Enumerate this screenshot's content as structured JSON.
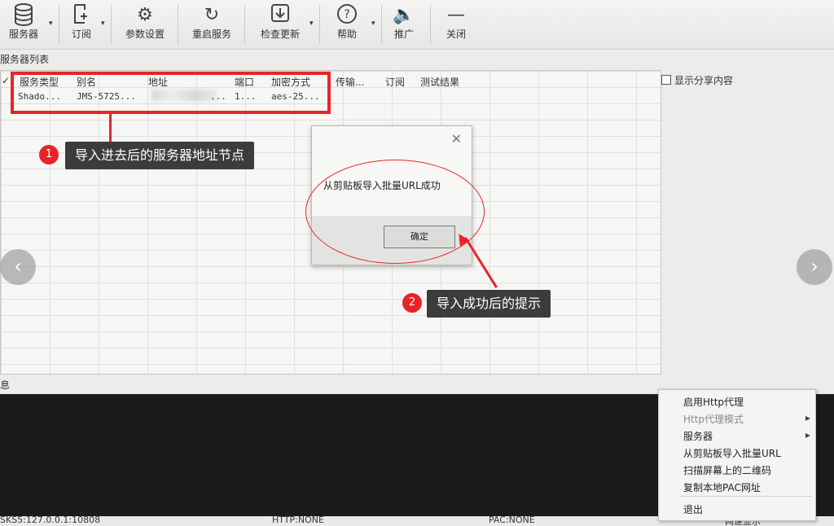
{
  "toolbar": {
    "items": [
      {
        "label": "服务器",
        "icon": "database-icon"
      },
      {
        "label": "订阅",
        "icon": "subscribe-icon"
      },
      {
        "label": "参数设置",
        "icon": "gear-icon"
      },
      {
        "label": "重启服务",
        "icon": "restart-icon"
      },
      {
        "label": "检查更新",
        "icon": "download-icon"
      },
      {
        "label": "帮助",
        "icon": "help-icon"
      },
      {
        "label": "推广",
        "icon": "speaker-icon"
      },
      {
        "label": "关闭",
        "icon": "minus-icon"
      }
    ]
  },
  "server_list": {
    "title": "服务器列表",
    "columns": [
      "服务类型",
      "别名",
      "地址",
      "端口",
      "加密方式",
      "传输...",
      "订阅",
      "测试结果"
    ],
    "rows": [
      {
        "type": "Shado...",
        "alias": "JMS-5725...",
        "address": "...",
        "port": "1...",
        "encryption": "aes-25..."
      }
    ],
    "show_share": "显示分享内容"
  },
  "dialog": {
    "message": "从剪贴板导入批量URL成功",
    "ok_label": "确定",
    "close_glyph": "✕"
  },
  "annotations": [
    {
      "badge": "1",
      "text": "导入进去后的服务器地址节点"
    },
    {
      "badge": "2",
      "text": "导入成功后的提示"
    }
  ],
  "info_label": "息",
  "status_bar": {
    "left": "SKS5:127.0.0.1:10808",
    "http": "HTTP:NONE",
    "pac": "PAC:NONE",
    "speed": "网速显示"
  },
  "context_menu": {
    "items": [
      {
        "label": "启用Http代理",
        "disabled": false
      },
      {
        "label": "Http代理模式",
        "disabled": true
      },
      {
        "label": "服务器",
        "disabled": false
      },
      {
        "label": "从剪贴板导入批量URL",
        "disabled": false
      },
      {
        "label": "扫描屏幕上的二维码",
        "disabled": false
      },
      {
        "label": "复制本地PAC网址",
        "disabled": false
      },
      {
        "label": "退出",
        "disabled": false
      }
    ]
  },
  "colors": {
    "annotation_red": "#e8242a",
    "callout_bg": "#3c3c3c",
    "log_bg": "#1b1b1d"
  }
}
